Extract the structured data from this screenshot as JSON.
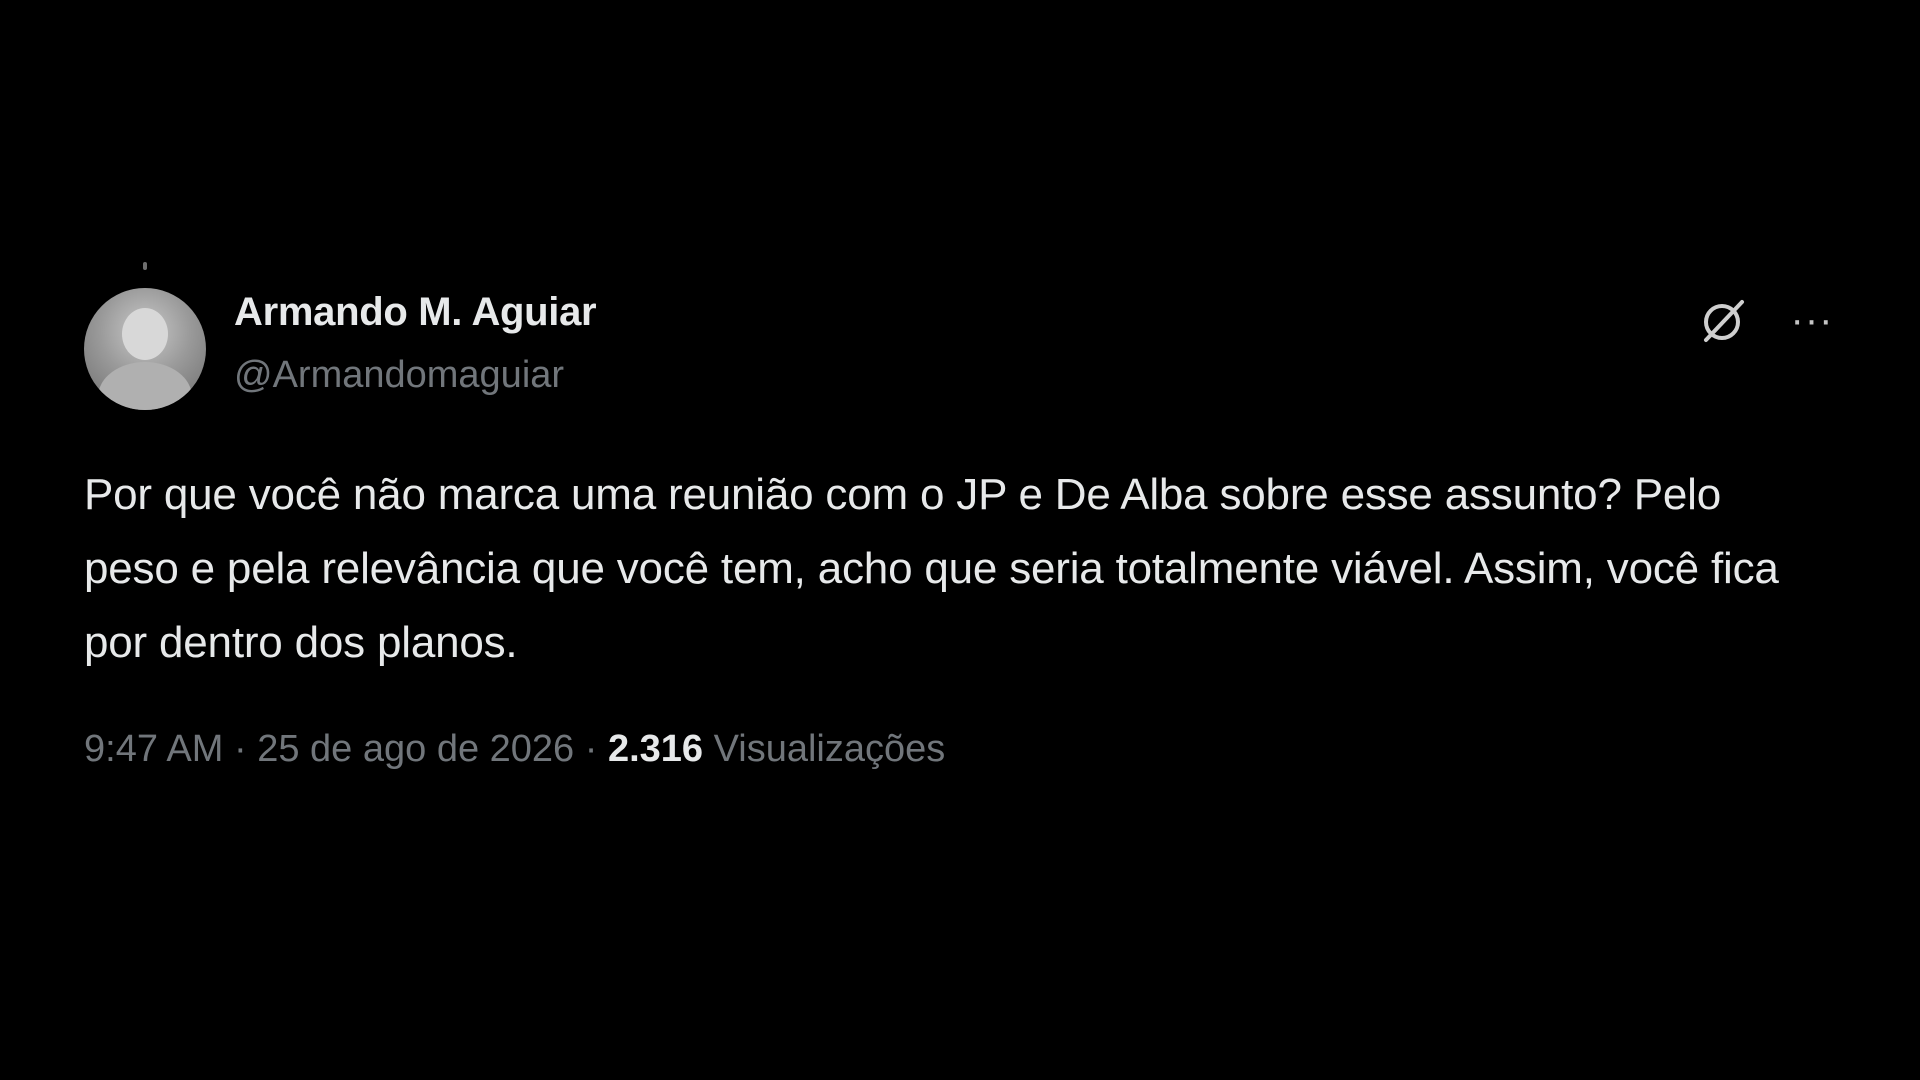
{
  "tweet": {
    "author_name": "Armando M. Aguiar",
    "author_handle": "@Armandomaguiar",
    "text": "Por que você não marca uma reunião com o JP e De Alba sobre esse assunto? Pelo peso e pela relevância que você tem, acho que seria totalmente viável. Assim, você fica por dentro dos planos.",
    "time": "9:47 AM",
    "separator": "·",
    "date": "25 de ago de 2026",
    "views_count": "2.316",
    "views_label": "Visualizações"
  },
  "icons": {
    "grok": "grok-icon",
    "more": "more-icon"
  },
  "colors": {
    "background": "#000000",
    "primary_text": "#e7e9ea",
    "secondary_text": "#71767b"
  }
}
